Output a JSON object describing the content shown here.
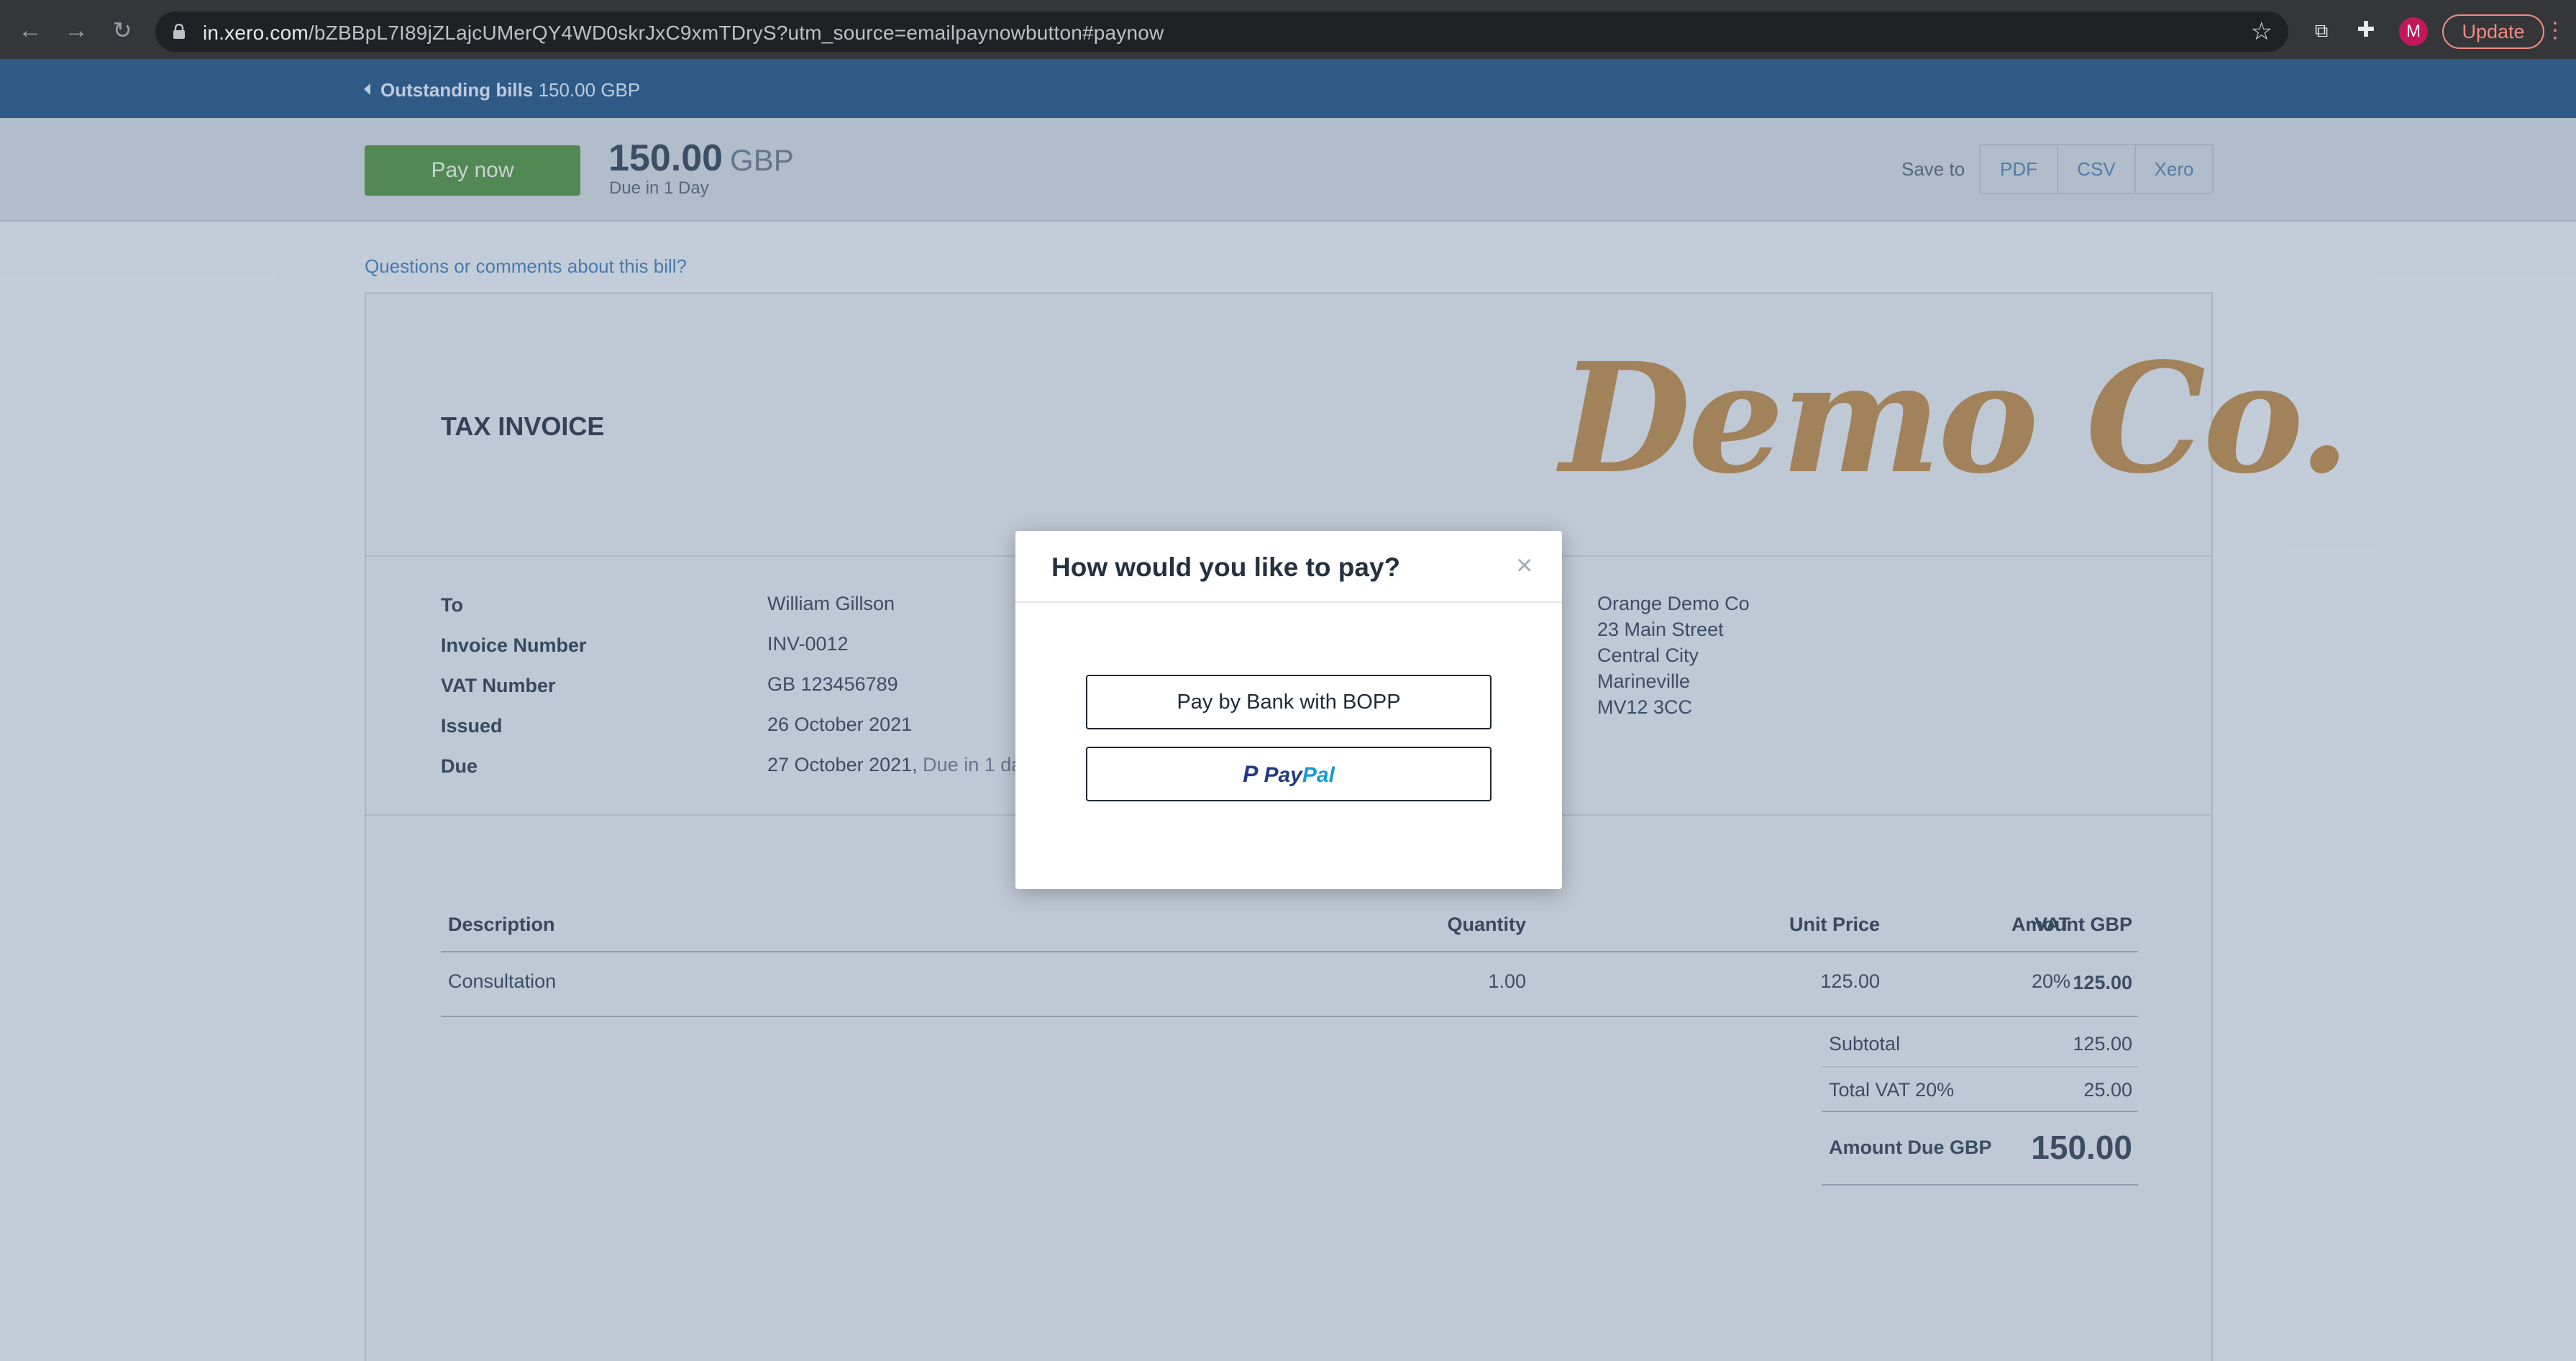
{
  "browser": {
    "url_host": "in.xero.com",
    "url_path": "/bZBBpL7I89jZLajcUMerQY4WD0skrJxC9xmTDryS?utm_source=emailpaynowbutton#paynow",
    "avatar_letter": "M",
    "update_label": "Update"
  },
  "breadcrumb": {
    "label": "Outstanding bills",
    "amount": "150.00 GBP"
  },
  "paybar": {
    "pay_now_label": "Pay now",
    "amount": "150.00",
    "currency": "GBP",
    "due": "Due in 1 Day",
    "save_to_label": "Save to",
    "save_options": [
      "PDF",
      "CSV",
      "Xero"
    ]
  },
  "question_link": "Questions or comments about this bill?",
  "invoice": {
    "title": "TAX INVOICE",
    "logo_text": "Demo Co.",
    "meta": [
      {
        "label": "To",
        "value": "William Gillson"
      },
      {
        "label": "Invoice Number",
        "value": "INV-0012"
      },
      {
        "label": "VAT Number",
        "value": "GB 123456789"
      },
      {
        "label": "Issued",
        "value": "26 October 2021"
      },
      {
        "label": "Due",
        "value": "27 October 2021,",
        "sub": "Due in 1 day"
      }
    ],
    "from_address": [
      "Orange Demo Co",
      "23 Main Street",
      "Central City",
      "Marineville",
      "MV12 3CC"
    ],
    "columns": [
      "Description",
      "Quantity",
      "Unit Price",
      "VAT",
      "Amount GBP"
    ],
    "rows": [
      {
        "description": "Consultation",
        "quantity": "1.00",
        "unit_price": "125.00",
        "vat": "20%",
        "amount": "125.00"
      }
    ],
    "subtotal_label": "Subtotal",
    "subtotal": "125.00",
    "vat_label": "Total VAT 20%",
    "vat_total": "25.00",
    "amount_due_label": "Amount Due GBP",
    "amount_due": "150.00"
  },
  "modal": {
    "title": "How would you like to pay?",
    "close_glyph": "×",
    "bopp_label": "Pay by Bank with BOPP",
    "paypal_pay": "Pay",
    "paypal_pal": "Pal"
  },
  "colors": {
    "header_blue": "#2a5a8a",
    "pay_now_green": "#53924b",
    "link_blue": "#4a80b7",
    "logo_orange": "#b68a52",
    "paypal_dark": "#253b80",
    "paypal_light": "#179bd7"
  }
}
